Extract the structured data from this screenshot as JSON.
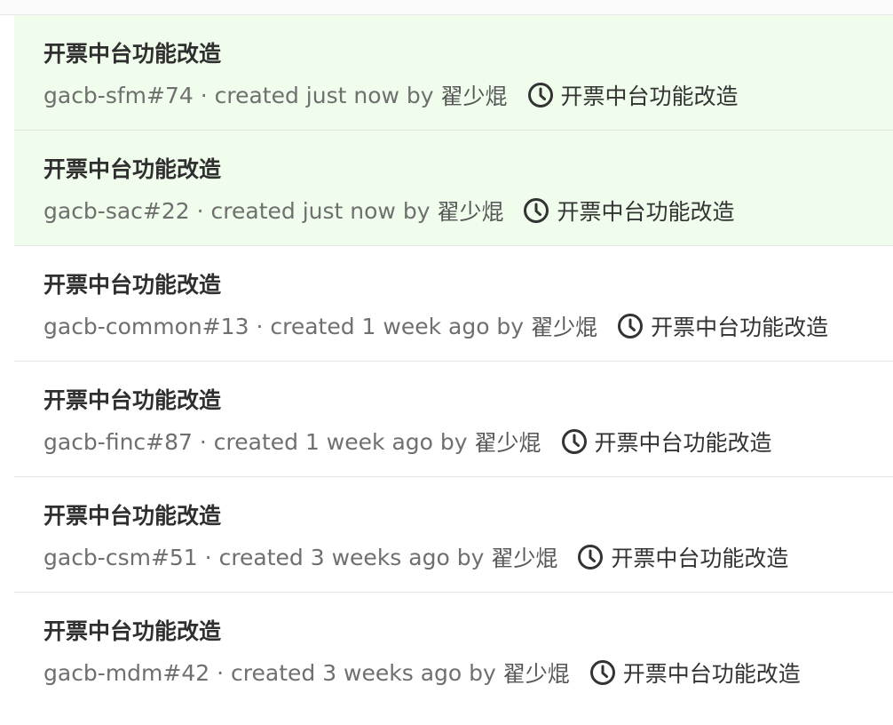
{
  "items": [
    {
      "title": "开票中台功能改造",
      "ref": "gacb-sfm#74",
      "created": "created just now by",
      "author": "翟少焜",
      "milestone": "开票中台功能改造",
      "highlighted": true
    },
    {
      "title": "开票中台功能改造",
      "ref": "gacb-sac#22",
      "created": "created just now by",
      "author": "翟少焜",
      "milestone": "开票中台功能改造",
      "highlighted": true
    },
    {
      "title": "开票中台功能改造",
      "ref": "gacb-common#13",
      "created": "created 1 week ago by",
      "author": "翟少焜",
      "milestone": "开票中台功能改造",
      "highlighted": false
    },
    {
      "title": "开票中台功能改造",
      "ref": "gacb-finc#87",
      "created": "created 1 week ago by",
      "author": "翟少焜",
      "milestone": "开票中台功能改造",
      "highlighted": false
    },
    {
      "title": "开票中台功能改造",
      "ref": "gacb-csm#51",
      "created": "created 3 weeks ago by",
      "author": "翟少焜",
      "milestone": "开票中台功能改造",
      "highlighted": false
    },
    {
      "title": "开票中台功能改造",
      "ref": "gacb-mdm#42",
      "created": "created 3 weeks ago by",
      "author": "翟少焜",
      "milestone": "开票中台功能改造",
      "highlighted": false
    }
  ],
  "separator": "·",
  "icons": {
    "milestone": "clock-icon"
  },
  "colors": {
    "highlight_bg": "#f0fdec",
    "divider": "#e5e5e5"
  }
}
